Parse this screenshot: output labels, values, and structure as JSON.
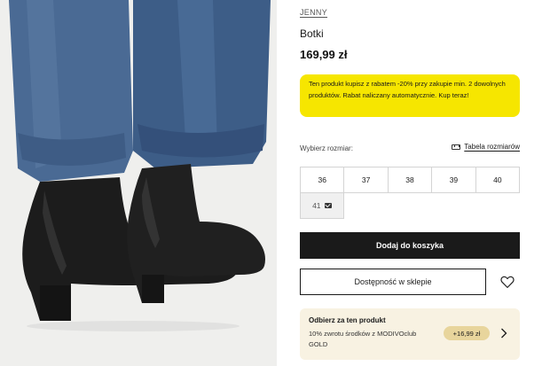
{
  "product": {
    "brand": "JENNY",
    "name": "Botki",
    "price": "169,99 zł",
    "promo_text": "Ten produkt kupisz z rabatem -20% przy zakupie min. 2 dowolnych produktów. Rabat naliczany automatycznie. Kup teraz!"
  },
  "size_selector": {
    "label": "Wybierz rozmiar:",
    "chart_link": "Tabela rozmiarów",
    "sizes": [
      "36",
      "37",
      "38",
      "39",
      "40"
    ],
    "unavailable_size": "41"
  },
  "actions": {
    "add_to_cart": "Dodaj do koszyka",
    "store_availability": "Dostępność w sklepie"
  },
  "reward": {
    "title": "Odbierz za ten produkt",
    "text": "10% zwrotu środków z MODIVOclub GOLD",
    "amount": "+16,99 zł"
  },
  "icons": {
    "size_chart": "ruler-icon",
    "notify": "mail-icon",
    "wishlist": "heart-icon",
    "reward_arrow": "chevron-right-icon"
  },
  "colors": {
    "promo": "#f6e600",
    "primary_button": "#1a1a1a",
    "reward_bg": "#f8f2e2"
  }
}
